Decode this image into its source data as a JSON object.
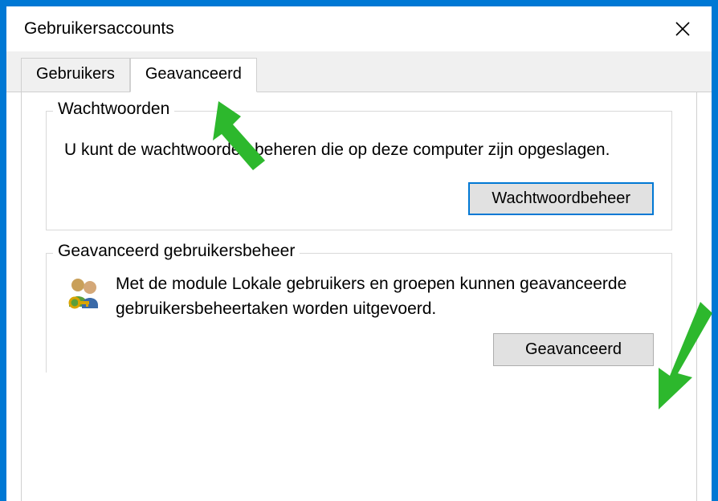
{
  "window": {
    "title": "Gebruikersaccounts"
  },
  "tabs": {
    "users": "Gebruikers",
    "advanced": "Geavanceerd"
  },
  "passwords_group": {
    "title": "Wachtwoorden",
    "text": "U kunt de wachtwoorden beheren die op deze computer zijn opgeslagen.",
    "button": "Wachtwoordbeheer"
  },
  "advanced_group": {
    "title": "Geavanceerd gebruikersbeheer",
    "text": "Met de module Lokale gebruikers en groepen kunnen geavanceerde gebruikersbeheertaken worden uitgevoerd.",
    "button": "Geavanceerd"
  },
  "colors": {
    "accent": "#0078d4",
    "annotation": "#2db82d"
  }
}
